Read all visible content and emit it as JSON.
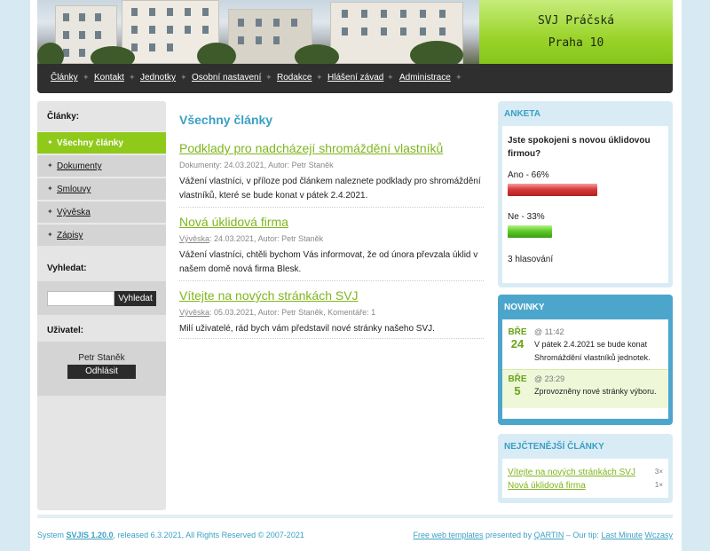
{
  "header": {
    "title_line1": "SVJ Práčská",
    "title_line2": "Praha 10"
  },
  "nav": [
    "Články",
    "Kontakt",
    "Jednotky",
    "Osobní nastavení",
    "Rodakce",
    "Hlášení závad",
    "Administrace"
  ],
  "sidebar": {
    "articles_heading": "Články:",
    "items": [
      {
        "label": "Všechny články",
        "active": true
      },
      {
        "label": "Dokumenty"
      },
      {
        "label": "Smlouvy"
      },
      {
        "label": "Vývěska"
      },
      {
        "label": "Zápisy"
      }
    ],
    "search_heading": "Vyhledat:",
    "search_button": "Vyhledat",
    "user_heading": "Uživatel:",
    "user_name": "Petr Staněk",
    "logout_button": "Odhlásit"
  },
  "main": {
    "heading": "Všechny články",
    "articles": [
      {
        "title": "Podklady pro nadcházejí shromáždění vlastníků",
        "meta": "Dokumenty: 24.03.2021, Autor: Petr Staněk",
        "body": "Vážení vlastníci, v příloze pod článkem naleznete podklady pro shromáždění vlastníků, které se bude konat v pátek 2.4.2021."
      },
      {
        "title": "Nová úklidová firma",
        "meta_cat": "Vývěska",
        "meta": ": 24.03.2021, Autor: Petr Staněk",
        "body": "Vážení vlastníci, chtěli bychom Vás informovat, že od února převzala úklid v našem domě nová firma Blesk."
      },
      {
        "title": "Vítejte na nových stránkách SVJ",
        "meta_cat": "Vývěska",
        "meta": ": 05.03.2021, Autor: Petr Staněk, Komentáře: 1",
        "body": "Milí uživatelé, rád bych vám představil nové stránky našeho SVJ."
      }
    ]
  },
  "poll": {
    "heading": "ANKETA",
    "question": "Jste spokojeni s novou úklidovou firmou?",
    "options": [
      {
        "label": "Ano - 66%",
        "percent": 66,
        "color": "#c62a2a"
      },
      {
        "label": "Ne - 33%",
        "percent": 33,
        "color": "#4fbf1f"
      }
    ],
    "votes": "3 hlasování"
  },
  "news": {
    "heading": "NOVINKY",
    "items": [
      {
        "dow": "BŘE",
        "day": "24",
        "time": "@ 11:42",
        "text": "V pátek 2.4.2021 se bude konat Shromáždění vlastníků jednotek."
      },
      {
        "dow": "BŘE",
        "day": "5",
        "time": "@ 23:29",
        "text": "Zprovozněny nové stránky výboru."
      }
    ]
  },
  "popular": {
    "heading": "NEJČTENĚJŠÍ ČLÁNKY",
    "items": [
      {
        "label": "Vítejte na nových stránkách SVJ",
        "count": "3×"
      },
      {
        "label": "Nová úklidová firma",
        "count": "1×"
      }
    ]
  },
  "footer": {
    "left_prefix": "System ",
    "left_version": "SVJIS 1.20.0",
    "left_suffix": ", released 6.3.2021, All Rights Reserved © 2007-2021",
    "right_link1": "Free web templates",
    "right_mid": " presented by ",
    "right_link2": "QARTIN",
    "right_tip": " – Our tip: ",
    "right_link3": "Last Minute",
    "right_link4": "Wczasy"
  }
}
